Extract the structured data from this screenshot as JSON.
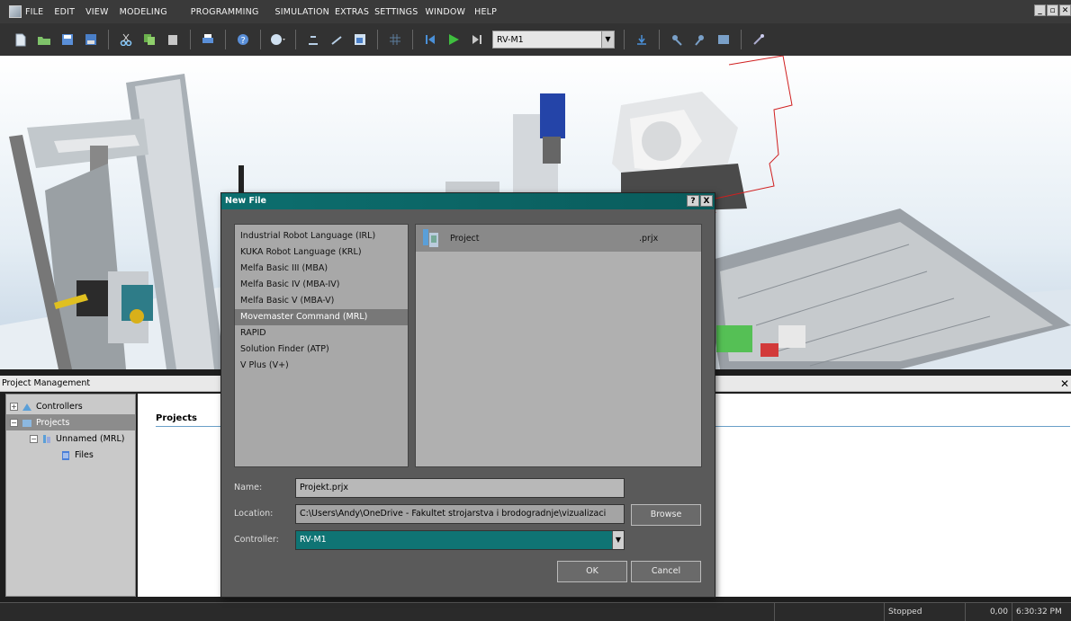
{
  "menu": {
    "items": [
      "FILE",
      "EDIT",
      "VIEW",
      "MODELING",
      "PROGRAMMING",
      "SIMULATION",
      "EXTRAS",
      "SETTINGS",
      "WINDOW",
      "HELP"
    ]
  },
  "toolbar": {
    "robot_select_value": "RV-M1"
  },
  "project_management": {
    "title": "Project Management",
    "tree": {
      "controllers": "Controllers",
      "projects": "Projects",
      "unnamed": "Unnamed (MRL)",
      "files": "Files"
    },
    "content_title": "Projects"
  },
  "dialog": {
    "title": "New File",
    "help_button": "?",
    "close_button": "X",
    "languages": [
      "Industrial Robot Language (IRL)",
      "KUKA Robot Language (KRL)",
      "Melfa Basic III (MBA)",
      "Melfa Basic IV (MBA-IV)",
      "Melfa Basic V (MBA-V)",
      "Movemaster Command (MRL)",
      "RAPID",
      "Solution Finder (ATP)",
      "V Plus (V+)"
    ],
    "selected_language_index": 5,
    "file_types": [
      {
        "name": "Project",
        "extension": ".prjx"
      }
    ],
    "name_label": "Name:",
    "name_value": "Projekt.prjx",
    "location_label": "Location:",
    "location_value": "C:\\Users\\Andy\\OneDrive - Fakultet strojarstva i brodogradnje\\vizualizaci",
    "browse_label": "Browse",
    "controller_label": "Controller:",
    "controller_value": "RV-M1",
    "ok_label": "OK",
    "cancel_label": "Cancel"
  },
  "statusbar": {
    "state": "Stopped",
    "value": "0,00",
    "time": "6:30:32 PM"
  },
  "colors": {
    "accent_teal": "#0f7474",
    "menubar_bg": "#3a3a3a"
  }
}
